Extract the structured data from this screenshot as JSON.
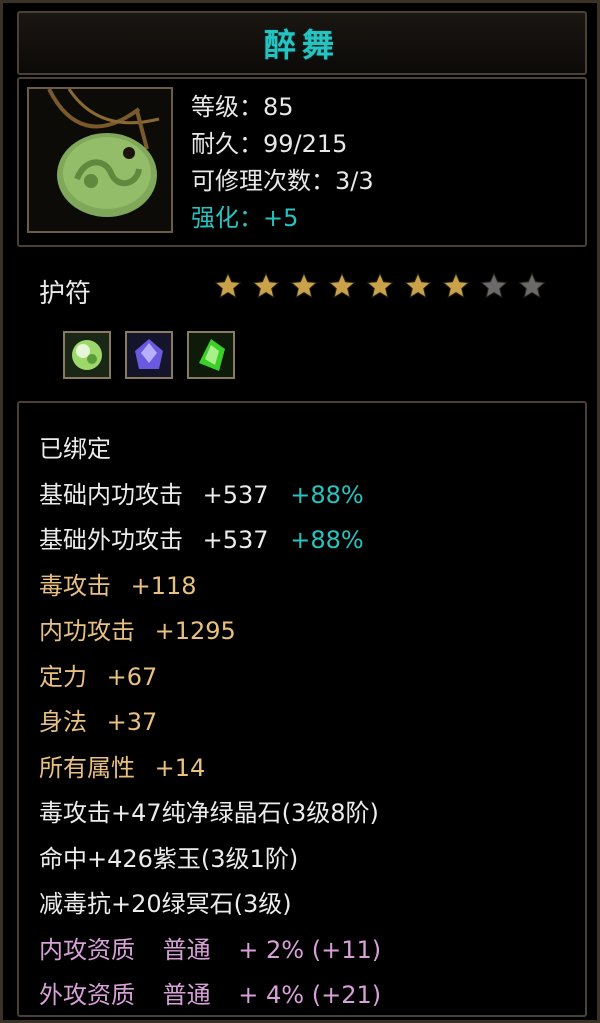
{
  "item": {
    "name": "醉舞",
    "stats": {
      "level": "等级：85",
      "durability": "耐久：99/215",
      "repairs": "可修理次数：3/3",
      "enhance": "强化：+5"
    },
    "category": "护符",
    "stars": {
      "total": 9,
      "filled": 7
    },
    "gems": [
      {
        "icon": "green-white-gem-icon",
        "color": "#9fd86a"
      },
      {
        "icon": "purple-gem-icon",
        "color": "#6a5ae0"
      },
      {
        "icon": "green-crystal-icon",
        "color": "#3ccf2a"
      }
    ],
    "bound": "已绑定",
    "attributes": [
      {
        "label": "基础内功攻击",
        "value": "+537",
        "extra": "+88%"
      },
      {
        "label": "基础外功攻击",
        "value": "+537",
        "extra": "+88%"
      }
    ],
    "bonuses": [
      {
        "label": "毒攻击",
        "value": "+118"
      },
      {
        "label": "内功攻击",
        "value": "+1295"
      },
      {
        "label": "定力",
        "value": "+67"
      },
      {
        "label": "身法",
        "value": "+37"
      },
      {
        "label": "所有属性",
        "value": "+14"
      }
    ],
    "gem_effects": [
      "毒攻击+47纯净绿晶石(3级8阶)",
      "命中+426紫玉(3级1阶)",
      "减毒抗+20绿冥石(3级)"
    ],
    "qualities": [
      {
        "label": "内攻资质",
        "grade": "普通",
        "bonus": "+ 2% (+11)"
      },
      {
        "label": "外攻资质",
        "grade": "普通",
        "bonus": "+ 4% (+21)"
      }
    ],
    "colors": {
      "title": "#27c3c0",
      "bonus": "#e8c080",
      "quality": "#d8a0d8",
      "star_on": "#c9a24a",
      "star_off": "#6a6a6a"
    }
  }
}
